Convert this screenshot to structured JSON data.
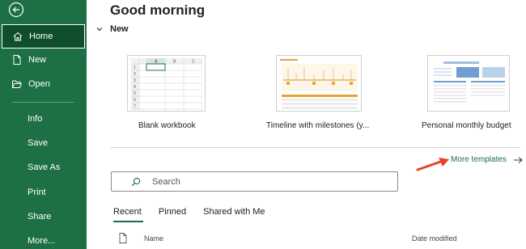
{
  "sidebar": {
    "items": [
      {
        "label": "Home",
        "icon": "home-icon"
      },
      {
        "label": "New",
        "icon": "new-file-icon"
      },
      {
        "label": "Open",
        "icon": "folder-open-icon"
      },
      {
        "label": "Info"
      },
      {
        "label": "Save"
      },
      {
        "label": "Save As"
      },
      {
        "label": "Print"
      },
      {
        "label": "Share"
      },
      {
        "label": "More..."
      }
    ]
  },
  "header": {
    "title": "Good morning"
  },
  "new_section": {
    "label": "New",
    "templates": [
      {
        "name": "Blank workbook",
        "columns": [
          "A",
          "B",
          "C"
        ],
        "rows": [
          "1",
          "2",
          "3",
          "4",
          "5",
          "6",
          "7"
        ]
      },
      {
        "name": "Timeline with milestones (y..."
      },
      {
        "name": "Personal monthly budget"
      }
    ],
    "more_templates": "More templates"
  },
  "search": {
    "placeholder": "Search"
  },
  "tabs": [
    {
      "label": "Recent",
      "active": true
    },
    {
      "label": "Pinned"
    },
    {
      "label": "Shared with Me"
    }
  ],
  "table": {
    "col_name": "Name",
    "col_date": "Date modified"
  },
  "colors": {
    "sidebar": "#1d7044",
    "accent": "#1d7044",
    "annotation_arrow": "#e8412c"
  }
}
